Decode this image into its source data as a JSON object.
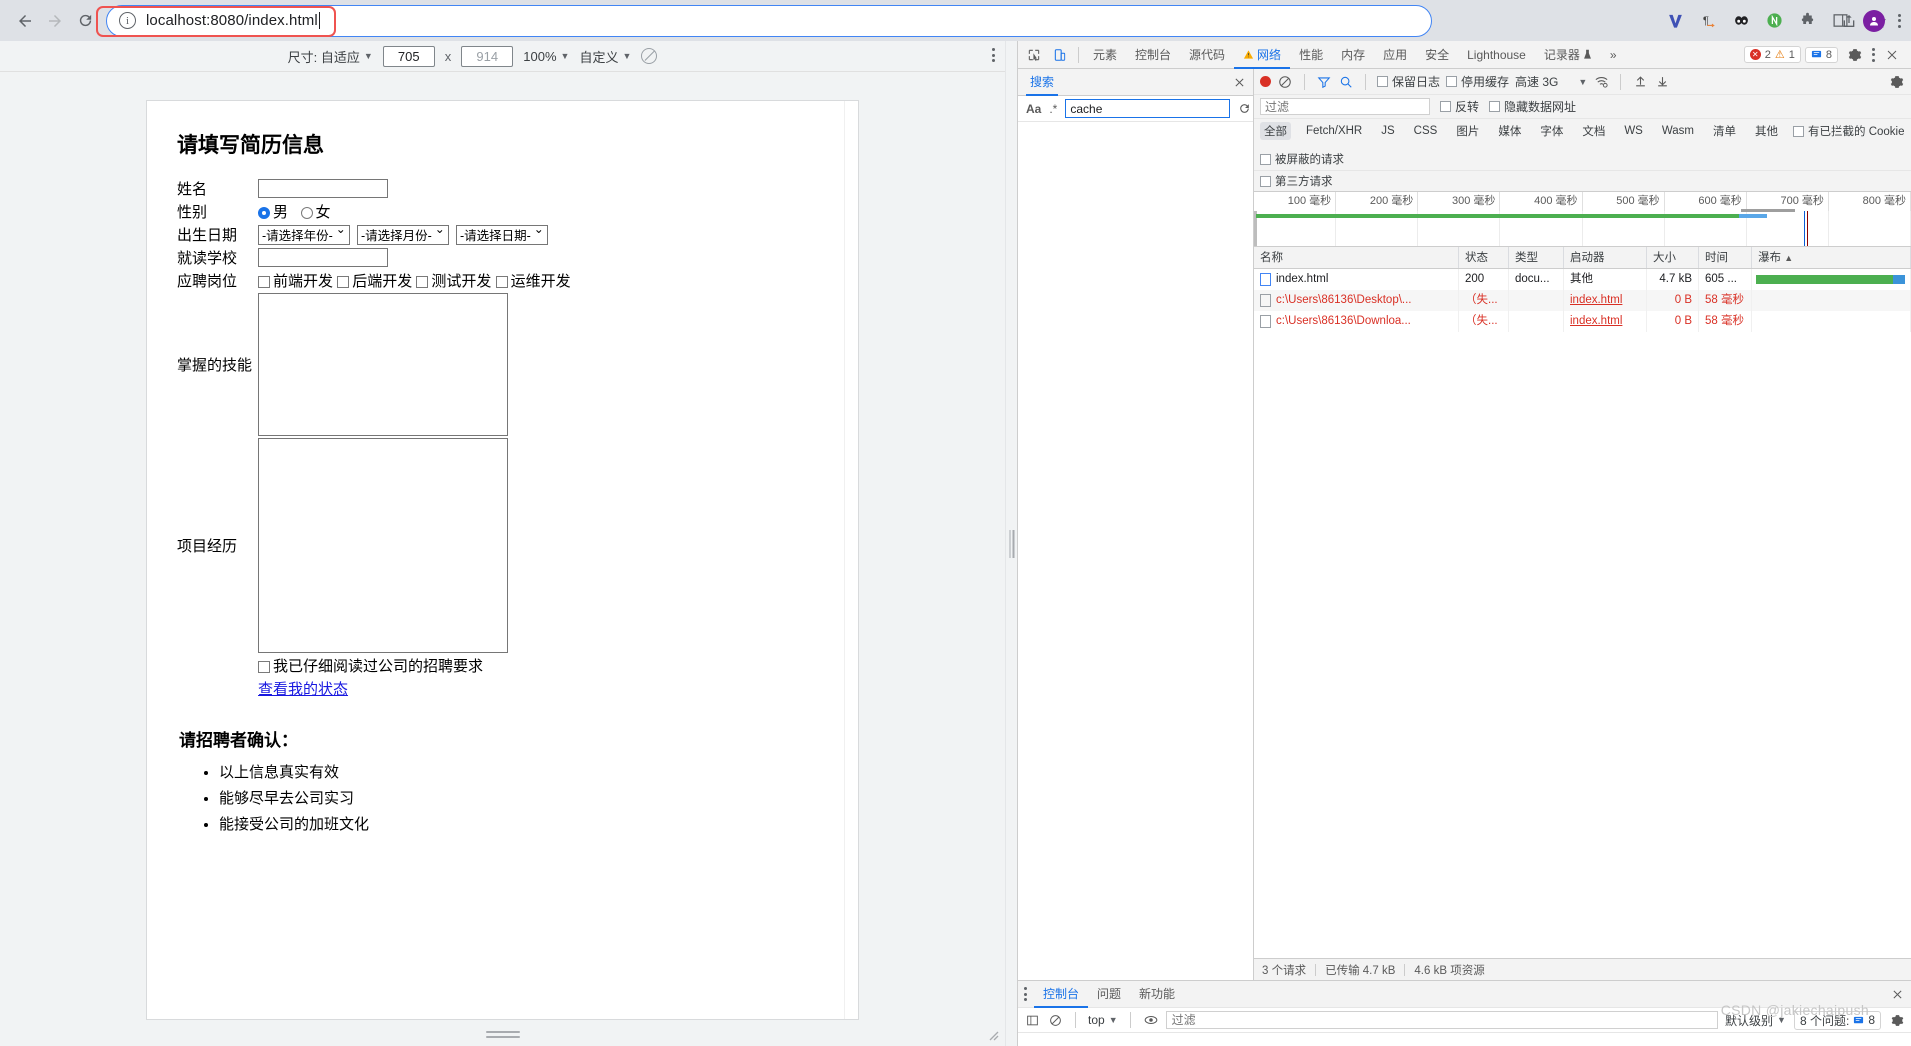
{
  "browser": {
    "back_label": "←",
    "forward_label": "→",
    "reload_label": "⟳",
    "url": "localhost:8080/index.html",
    "info_icon": "info-circle-icon",
    "share_icon": "share-icon",
    "bookmark_icon": "star-icon",
    "extensions": [
      "vimium-icon",
      "paragraph-icon",
      "panda-icon",
      "evernote-icon",
      "puzzle-icon",
      "sidebar-icon"
    ],
    "profile_initial": "",
    "menu_icon": "kebab-menu-icon"
  },
  "device_toolbar": {
    "size_label": "尺寸: 自适应",
    "width": "705",
    "height": "914",
    "zoom": "100%",
    "preset": "自定义",
    "throttle_icon": "no-throttling-icon",
    "more_icon": "kebab-menu-icon"
  },
  "page": {
    "title": "请填写简历信息",
    "fields": {
      "name_label": "姓名",
      "name_value": "",
      "gender_label": "性别",
      "gender_options": [
        "男",
        "女"
      ],
      "gender_selected": "男",
      "birth_label": "出生日期",
      "birth_selects": [
        "-请选择年份-",
        "-请选择月份-",
        "-请选择日期-"
      ],
      "school_label": "就读学校",
      "school_value": "",
      "job_label": "应聘岗位",
      "job_options": [
        "前端开发",
        "后端开发",
        "测试开发",
        "运维开发"
      ],
      "skills_label": "掌握的技能",
      "skills_value": "",
      "project_label": "项目经历",
      "project_value": "",
      "agree_label": "我已仔细阅读过公司的招聘要求",
      "status_link": "查看我的状态"
    },
    "confirm_title": "请招聘者确认：",
    "confirm_items": [
      "以上信息真实有效",
      "能够尽早去公司实习",
      "能接受公司的加班文化"
    ]
  },
  "devtools": {
    "inspect_icon": "inspect-element-icon",
    "device_icon": "device-toolbar-icon",
    "tabs": [
      {
        "label": "元素",
        "active": false,
        "warn": false
      },
      {
        "label": "控制台",
        "active": false,
        "warn": false
      },
      {
        "label": "源代码",
        "active": false,
        "warn": false
      },
      {
        "label": "网络",
        "active": true,
        "warn": true
      },
      {
        "label": "性能",
        "active": false,
        "warn": false
      },
      {
        "label": "内存",
        "active": false,
        "warn": false
      },
      {
        "label": "应用",
        "active": false,
        "warn": false
      },
      {
        "label": "安全",
        "active": false,
        "warn": false
      },
      {
        "label": "Lighthouse",
        "active": false,
        "warn": false
      },
      {
        "label": "记录器",
        "active": false,
        "warn": false
      }
    ],
    "more_tabs": "»",
    "errors_count": "2",
    "warnings_count": "1",
    "messages_count": "8",
    "settings_icon": "gear-icon",
    "menu_icon": "kebab-menu-icon",
    "close_icon": "close-icon"
  },
  "search": {
    "tab_label": "搜索",
    "close_icon": "close-icon",
    "match_case_label": "Aa",
    "regex_label": ".*",
    "query": "cache",
    "refresh_icon": "refresh-icon",
    "clear_icon": "clear-icon"
  },
  "network": {
    "record_icon": "record-icon",
    "clear_icon": "clear-icon",
    "filter_icon": "filter-icon",
    "search_icon": "search-icon",
    "preserve_log": "保留日志",
    "disable_cache": "停用缓存",
    "throttling": "高速 3G",
    "wifi_icon": "network-conditions-icon",
    "import_icon": "import-har-icon",
    "export_icon": "export-har-icon",
    "settings_icon": "gear-icon",
    "filter_placeholder": "过滤",
    "invert_label": "反转",
    "hide_data_urls_label": "隐藏数据网址",
    "types": [
      "全部",
      "Fetch/XHR",
      "JS",
      "CSS",
      "图片",
      "媒体",
      "字体",
      "文档",
      "WS",
      "Wasm",
      "清单",
      "其他"
    ],
    "active_type": "全部",
    "blocked_cookies_label": "有已拦截的 Cookie",
    "blocked_requests_label": "被屏蔽的请求",
    "third_party_label": "第三方请求",
    "timeline_ticks": [
      "100 毫秒",
      "200 毫秒",
      "300 毫秒",
      "400 毫秒",
      "500 毫秒",
      "600 毫秒",
      "700 毫秒",
      "800 毫秒"
    ],
    "columns": [
      "名称",
      "状态",
      "类型",
      "启动器",
      "大小",
      "时间",
      "瀑布"
    ],
    "sort_icon": "sort-ascending-icon",
    "rows": [
      {
        "name": "index.html",
        "status": "200",
        "type": "docu...",
        "initiator": "其他",
        "size": "4.7 kB",
        "time": "605 ...",
        "error": false,
        "icon": "document-icon"
      },
      {
        "name": "c:\\Users\\86136\\Desktop\\...",
        "status": "（失...",
        "type": "",
        "initiator": "index.html",
        "size": "0 B",
        "time": "58 毫秒",
        "error": true,
        "icon": "document-icon"
      },
      {
        "name": "c:\\Users\\86136\\Downloa...",
        "status": "（失...",
        "type": "",
        "initiator": "index.html",
        "size": "0 B",
        "time": "58 毫秒",
        "error": true,
        "icon": "document-icon"
      }
    ],
    "status_requests": "3 个请求",
    "status_transferred": "已传输 4.7 kB",
    "status_resources": "4.6 kB 项资源"
  },
  "console_drawer": {
    "menu_icon": "kebab-menu-icon",
    "tabs": [
      {
        "label": "控制台",
        "active": true
      },
      {
        "label": "问题",
        "active": false
      },
      {
        "label": "新功能",
        "active": false
      }
    ],
    "close_icon": "close-icon",
    "sidebar_icon": "console-sidebar-icon",
    "clear_icon": "clear-console-icon",
    "context": "top",
    "eye_icon": "live-expression-icon",
    "filter_placeholder": "过滤",
    "level": "默认级别",
    "issues_label": "8 个问题:",
    "issues_count": "8",
    "settings_icon": "gear-icon"
  },
  "watermark": "CSDN @jakiechaipush",
  "colors": {
    "accent": "#1a73e8",
    "error": "#d93025",
    "warn": "#e37400",
    "success": "#4caf50",
    "chrome_bg": "#dee1e6",
    "highlight": "#ef5350"
  }
}
